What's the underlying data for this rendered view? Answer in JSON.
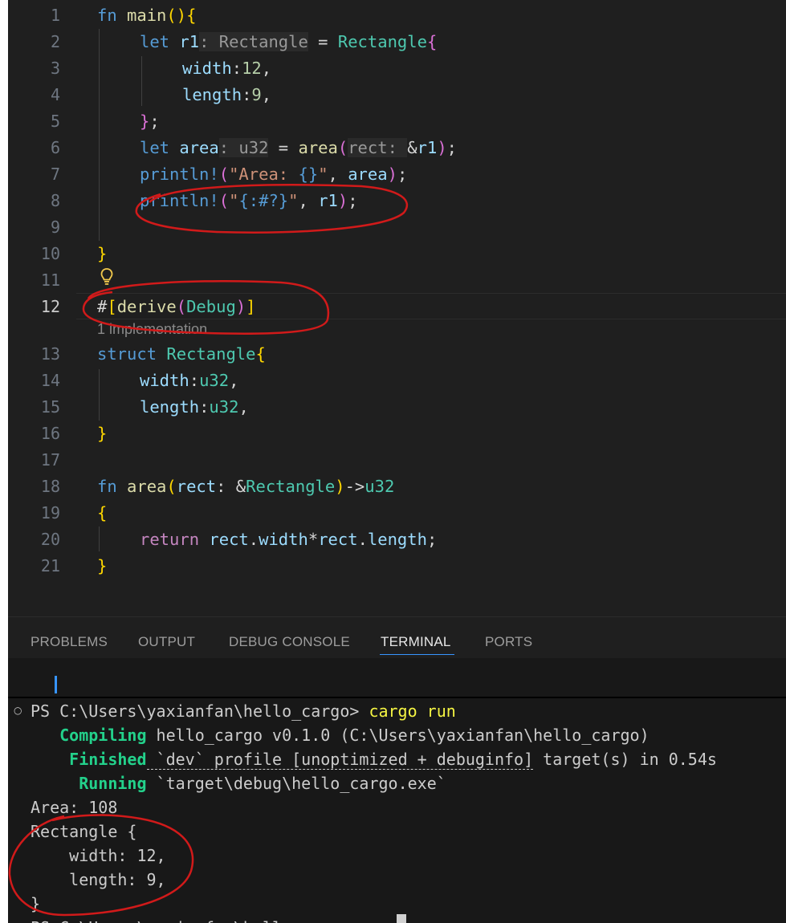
{
  "editor": {
    "lines": [
      {
        "num": "1",
        "tokens": [
          [
            "kw",
            "fn "
          ],
          [
            "fn",
            "main"
          ],
          [
            "b1",
            "(){"
          ]
        ]
      },
      {
        "num": "2",
        "tokens": [
          [
            "kw",
            "let "
          ],
          [
            "var",
            "r1"
          ],
          [
            "hint",
            ": Rectangle"
          ],
          [
            "op",
            " = "
          ],
          [
            "ty",
            "Rectangle"
          ],
          [
            "b2",
            "{"
          ]
        ]
      },
      {
        "num": "3",
        "tokens": [
          [
            "var",
            "width"
          ],
          [
            "op",
            ":"
          ],
          [
            "num",
            "12"
          ],
          [
            "op",
            ","
          ]
        ]
      },
      {
        "num": "4",
        "tokens": [
          [
            "var",
            "length"
          ],
          [
            "op",
            ":"
          ],
          [
            "num",
            "9"
          ],
          [
            "op",
            ","
          ]
        ]
      },
      {
        "num": "5",
        "tokens": [
          [
            "b2",
            "}"
          ],
          [
            "op",
            ";"
          ]
        ]
      },
      {
        "num": "6",
        "tokens": [
          [
            "kw",
            "let "
          ],
          [
            "var",
            "area"
          ],
          [
            "hint",
            ": u32"
          ],
          [
            "op",
            " = "
          ],
          [
            "fn",
            "area"
          ],
          [
            "b2",
            "("
          ],
          [
            "hint",
            "rect: "
          ],
          [
            "op",
            "&"
          ],
          [
            "var",
            "r1"
          ],
          [
            "b2",
            ")"
          ],
          [
            "op",
            ";"
          ]
        ]
      },
      {
        "num": "7",
        "tokens": [
          [
            "mac",
            "println!"
          ],
          [
            "b2",
            "("
          ],
          [
            "str",
            "\"Area: "
          ],
          [
            "kw",
            "{}"
          ],
          [
            "str",
            "\""
          ],
          [
            "op",
            ", "
          ],
          [
            "var",
            "area"
          ],
          [
            "b2",
            ")"
          ],
          [
            "op",
            ";"
          ]
        ]
      },
      {
        "num": "8",
        "tokens": [
          [
            "mac",
            "println!"
          ],
          [
            "b2",
            "("
          ],
          [
            "str",
            "\""
          ],
          [
            "kw",
            "{:#?}"
          ],
          [
            "str",
            "\""
          ],
          [
            "op",
            ", "
          ],
          [
            "var",
            "r1"
          ],
          [
            "b2",
            ")"
          ],
          [
            "op",
            ";"
          ]
        ]
      },
      {
        "num": "9",
        "tokens": []
      },
      {
        "num": "10",
        "tokens": [
          [
            "b1",
            "}"
          ]
        ]
      },
      {
        "num": "11",
        "tokens": []
      },
      {
        "num": "12",
        "tokens": [
          [
            "op",
            "#"
          ],
          [
            "b1",
            "["
          ],
          [
            "fn",
            "derive"
          ],
          [
            "b2",
            "("
          ],
          [
            "ty",
            "Debug"
          ],
          [
            "b2",
            ")"
          ],
          [
            "b1",
            "]"
          ]
        ]
      },
      {
        "num": "13",
        "tokens": [
          [
            "kw",
            "struct "
          ],
          [
            "ty",
            "Rectangle"
          ],
          [
            "b1",
            "{"
          ]
        ]
      },
      {
        "num": "14",
        "tokens": [
          [
            "var",
            "width"
          ],
          [
            "op",
            ":"
          ],
          [
            "ty",
            "u32"
          ],
          [
            "op",
            ","
          ]
        ]
      },
      {
        "num": "15",
        "tokens": [
          [
            "var",
            "length"
          ],
          [
            "op",
            ":"
          ],
          [
            "ty",
            "u32"
          ],
          [
            "op",
            ","
          ]
        ]
      },
      {
        "num": "16",
        "tokens": [
          [
            "b1",
            "}"
          ]
        ]
      },
      {
        "num": "17",
        "tokens": []
      },
      {
        "num": "18",
        "tokens": [
          [
            "kw",
            "fn "
          ],
          [
            "fn",
            "area"
          ],
          [
            "b1",
            "("
          ],
          [
            "var",
            "rect"
          ],
          [
            "op",
            ": &"
          ],
          [
            "ty",
            "Rectangle"
          ],
          [
            "b1",
            ")"
          ],
          [
            "op",
            "->"
          ],
          [
            "ty",
            "u32"
          ]
        ]
      },
      {
        "num": "19",
        "tokens": [
          [
            "b1",
            "{"
          ]
        ]
      },
      {
        "num": "20",
        "tokens": [
          [
            "ctl",
            "return "
          ],
          [
            "var",
            "rect"
          ],
          [
            "op",
            "."
          ],
          [
            "var",
            "width"
          ],
          [
            "op",
            "*"
          ],
          [
            "var",
            "rect"
          ],
          [
            "op",
            "."
          ],
          [
            "var",
            "length"
          ],
          [
            "op",
            ";"
          ]
        ]
      },
      {
        "num": "21",
        "tokens": [
          [
            "b1",
            "}"
          ]
        ]
      }
    ],
    "codelens": "1 implementation",
    "active_line": "12"
  },
  "panel": {
    "tabs": [
      "PROBLEMS",
      "OUTPUT",
      "DEBUG CONSOLE",
      "TERMINAL",
      "PORTS"
    ],
    "active_tab": "TERMINAL"
  },
  "terminal": {
    "prompt": "PS C:\\Users\\yaxianfan\\hello_cargo> ",
    "command": "cargo run",
    "compiling_label": "Compiling",
    "compiling_text": " hello_cargo v0.1.0 (C:\\Users\\yaxianfan\\hello_cargo)",
    "finished_label": "Finished",
    "finished_text_1": " `dev` profile [unoptimized + debuginfo]",
    "finished_text_2": " target(s) in 0.54s",
    "running_label": "Running",
    "running_text": " `target\\debug\\hello_cargo.exe`",
    "output": [
      "Area: 108",
      "Rectangle {",
      "    width: 12,",
      "    length: 9,",
      "}"
    ],
    "last_prompt": "PS C:\\Users\\yaxianfan\\hello_cargo> "
  },
  "colors": {
    "editor_bg": "#1f1f1f",
    "terminal_bg": "#181818",
    "annotation": "#d11a1a",
    "accent": "#3794ff"
  }
}
